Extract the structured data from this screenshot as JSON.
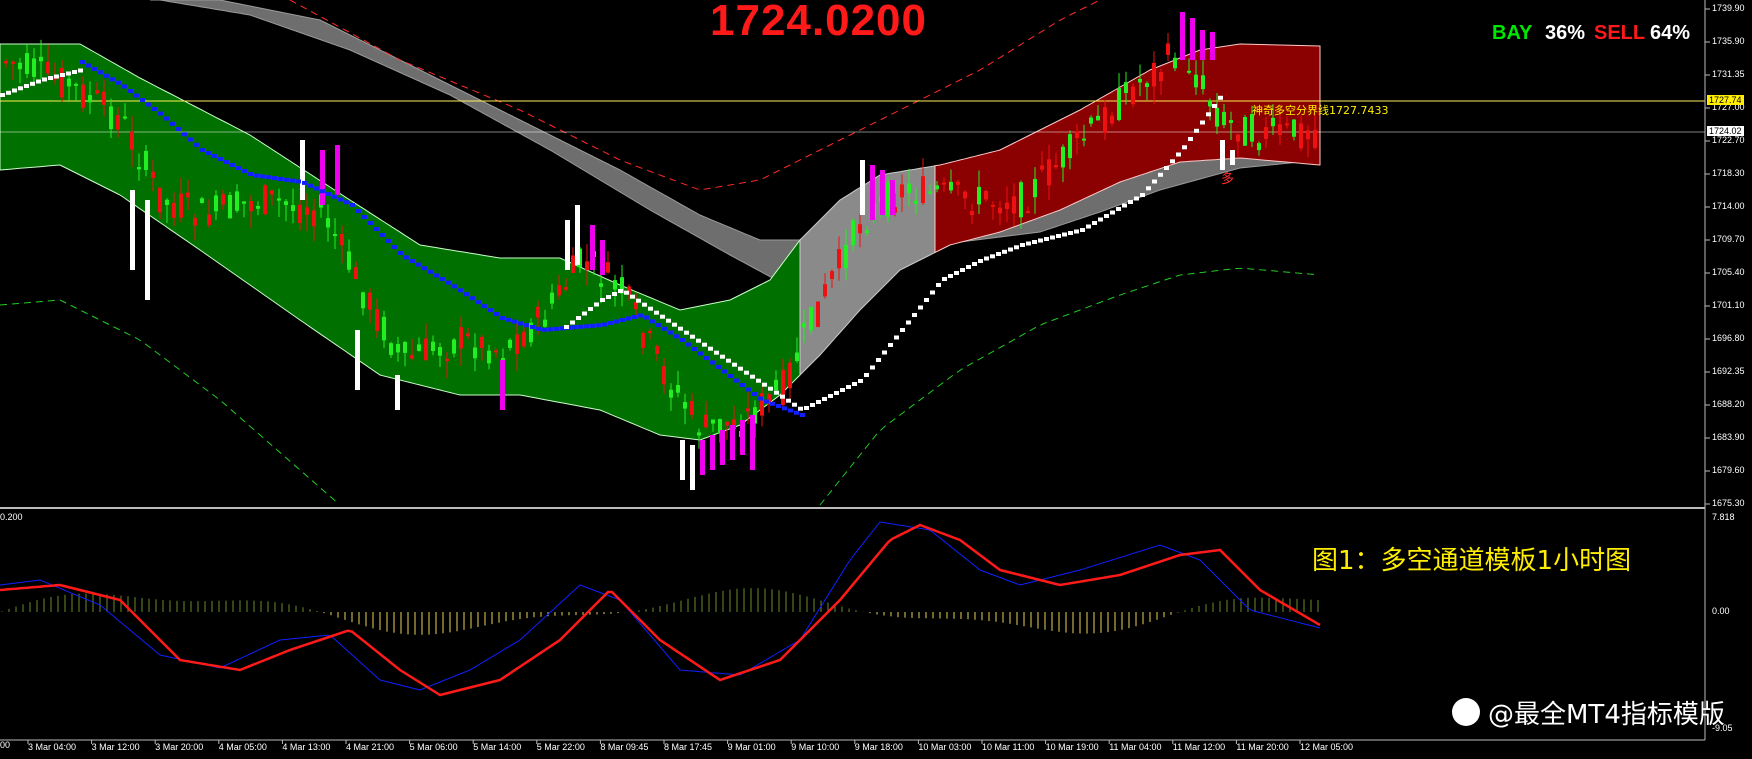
{
  "header": {
    "price": "1724.0200",
    "bay_label": "BAY",
    "bay_pct": "36%",
    "sell_label": "SELL",
    "sell_pct": "64%"
  },
  "annotations": {
    "boundary_label": "神奇多空分界线1727.7433",
    "duo_mark": "多",
    "caption": "图1：多空通道模板1小时图",
    "watermark": "@最全MT4指标模版",
    "indicator_tag": "0.200"
  },
  "price_axis": {
    "ticks": [
      "1739.90",
      "1735.90",
      "1731.35",
      "1727.00",
      "1722.70",
      "1718.30",
      "1714.00",
      "1709.70",
      "1705.40",
      "1701.10",
      "1696.80",
      "1692.35",
      "1688.20",
      "1683.90",
      "1679.60",
      "1675.30"
    ],
    "boundary_tag": "1727.74",
    "current_tag": "1724.02"
  },
  "indicator_axis": {
    "ticks": [
      "7.818",
      "0.00",
      "-9.05"
    ]
  },
  "time_axis": {
    "labels": [
      "3 Mar 04:00",
      "3 Mar 12:00",
      "3 Mar 20:00",
      "4 Mar 05:00",
      "4 Mar 13:00",
      "4 Mar 21:00",
      "5 Mar 06:00",
      "5 Mar 14:00",
      "5 Mar 22:00",
      "8 Mar 09:45",
      "8 Mar 17:45",
      "9 Mar 01:00",
      "9 Mar 10:00",
      "9 Mar 18:00",
      "10 Mar 03:00",
      "10 Mar 11:00",
      "10 Mar 19:00",
      "11 Mar 04:00",
      "11 Mar 12:00",
      "11 Mar 20:00",
      "12 Mar 05:00"
    ],
    "first_label_fragment": "00"
  },
  "colors": {
    "background": "#000000",
    "bull_channel": "#007000",
    "bear_channel": "#8b0000",
    "neutral_channel": "#8a8a8a",
    "gray_band": "#6e6e6e",
    "bull_candle": "#22ee22",
    "bear_candle": "#ee1111",
    "magenta_bar": "#ee00ee",
    "white_bar": "#ffffff",
    "blue_line": "#1020ff",
    "red_line": "#ff1a1a",
    "yellow_line": "#ffee55",
    "histogram": "#e8d05a"
  },
  "chart_data": {
    "type": "candlestick",
    "title": "",
    "price_range": [
      1675.3,
      1739.9
    ],
    "indicator_range": [
      -9.05,
      7.818
    ],
    "horizontal_lines": [
      1727.74,
      1724.02
    ]
  }
}
